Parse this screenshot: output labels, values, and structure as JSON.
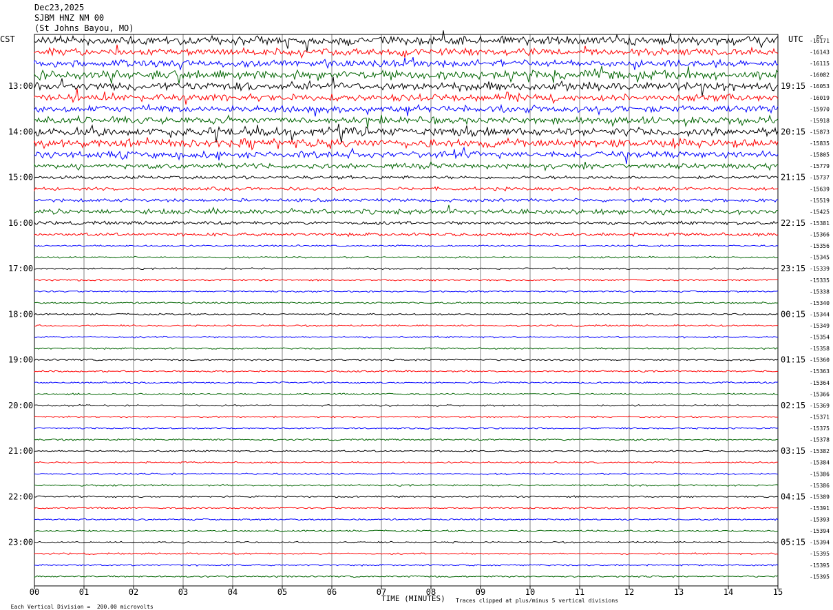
{
  "header": {
    "date": "Dec23,2025",
    "station": "SJBM HNZ NM 00",
    "location": "(St Johns Bayou, MO)"
  },
  "left_tz": "CST",
  "right_tz": "UTC",
  "dc_label": "DC",
  "footer": {
    "scale_note": "Each Vertical Division =  200.00 microvolts",
    "clip_note": "Traces clipped at plus/minus 5 vertical divisions"
  },
  "colors": {
    "trace": [
      "#000000",
      "#ff0000",
      "#0000ff",
      "#006400"
    ],
    "grid": "#808080"
  },
  "chart_data": {
    "type": "line",
    "title": "",
    "xlabel": "TIME (MINUTES)",
    "ylabel": "",
    "xlim": [
      0,
      15
    ],
    "grid": true,
    "x_ticks": [
      "00",
      "01",
      "02",
      "03",
      "04",
      "05",
      "06",
      "07",
      "08",
      "09",
      "10",
      "11",
      "12",
      "13",
      "14",
      "15"
    ],
    "hour_labels_left": [
      "13:00",
      "14:00",
      "15:00",
      "16:00",
      "17:00",
      "18:00",
      "19:00",
      "20:00",
      "21:00",
      "22:00",
      "23:00"
    ],
    "hour_labels_right": [
      "19:15",
      "20:15",
      "21:15",
      "22:15",
      "23:15",
      "00:15",
      "01:15",
      "02:15",
      "03:15",
      "04:15",
      "05:15"
    ],
    "dc_offsets": [
      -16171,
      -16143,
      -16115,
      -16082,
      -16053,
      -16019,
      -15970,
      -15918,
      -15873,
      -15835,
      -15805,
      -15779,
      -15737,
      -15639,
      -15519,
      -15425,
      -15381,
      -15366,
      -15356,
      -15345,
      -15339,
      -15335,
      -15338,
      -15340,
      -15344,
      -15349,
      -15354,
      -15358,
      -15360,
      -15363,
      -15364,
      -15366,
      -15369,
      -15371,
      -15375,
      -15378,
      -15382,
      -15384,
      -15386,
      -15386,
      -15389,
      -15391,
      -15393,
      -15394,
      -15394,
      -15395,
      -15395,
      -15395
    ],
    "trace_activity": [
      5,
      4,
      4,
      5,
      5,
      4,
      4,
      4,
      5,
      5,
      4,
      3,
      2,
      2,
      2,
      3,
      2,
      2,
      1,
      1,
      1,
      1,
      1,
      1,
      1,
      1,
      1,
      1,
      1,
      1,
      1,
      1,
      1,
      1,
      1,
      1,
      1,
      1,
      1,
      1,
      1,
      1,
      1,
      1,
      1,
      1,
      1,
      1
    ]
  }
}
